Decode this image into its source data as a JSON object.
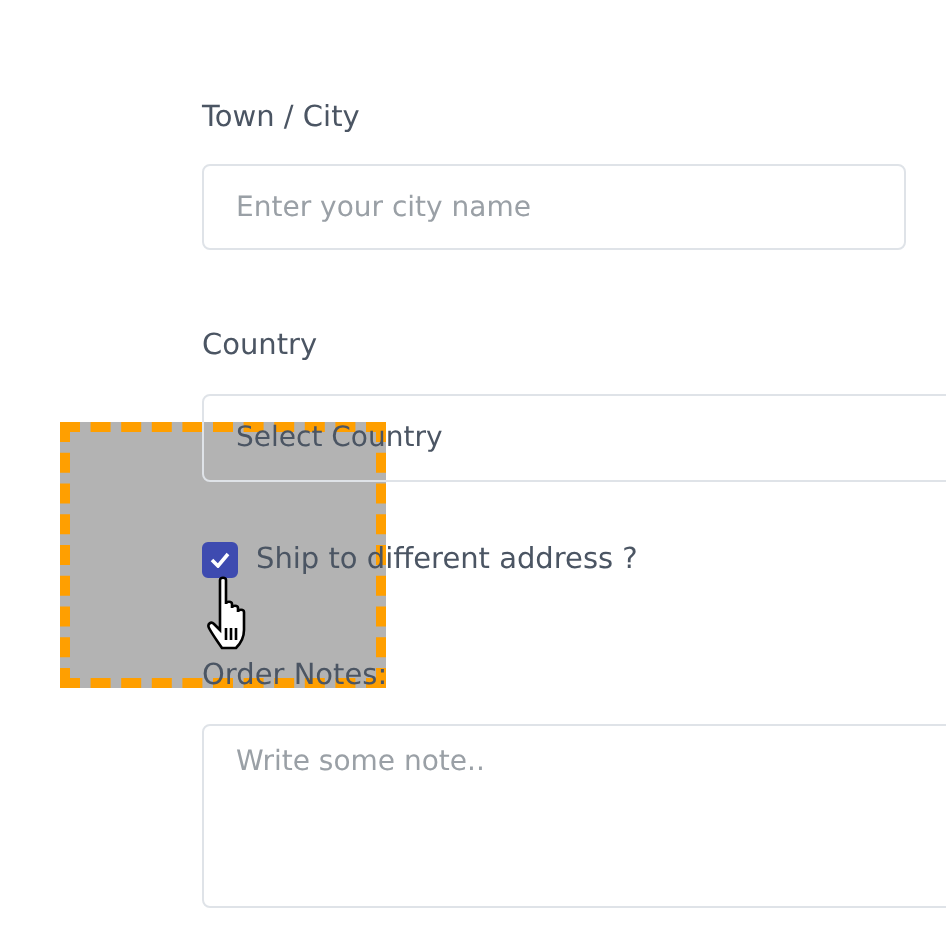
{
  "city": {
    "label": "Town / City",
    "placeholder": "Enter your city name"
  },
  "country": {
    "label": "Country",
    "placeholder": "Select Country"
  },
  "ship_different": {
    "label": "Ship to different address ?",
    "checked": true
  },
  "notes": {
    "label": "Order Notes:",
    "placeholder": "Write some note.."
  }
}
